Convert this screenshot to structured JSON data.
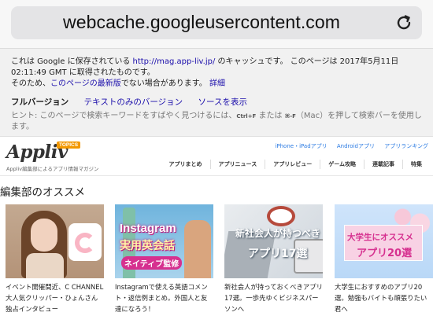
{
  "browser": {
    "url": "webcache.googleusercontent.com",
    "reload_icon": "reload-icon"
  },
  "cache_notice": {
    "line1_pre": "これは Google に保存されている ",
    "line1_link": "http://mag.app-liv.jp/",
    "line1_post": " のキャッシュです。 このページは 2017年5月11日",
    "line2": "02:11:49 GMT に取得されたものです。",
    "line3_pre": "そのため、",
    "line3_link": "このページの最新版",
    "line3_mid": "でない場合があります。 ",
    "line3_link2": "詳細",
    "full_version": "フルバージョン",
    "text_only": "テキストのみのバージョン",
    "view_source": "ソースを表示",
    "hint_pre": "ヒント: このページで検索キーワードをすばやく見つけるには、",
    "hint_key1": "Ctrl+F",
    "hint_mid": " または ",
    "hint_key2": "⌘-F",
    "hint_post": "（Mac）を押して検索バーを使用します。"
  },
  "site": {
    "logo_text": "Appliv",
    "logo_badge": "TOPICS",
    "tagline": "Appliv編集部によるアプリ情報マガジン",
    "top_links": [
      "iPhone・iPadアプリ",
      "Androidアプリ",
      "アプリランキング"
    ],
    "nav": [
      "アプリまとめ",
      "アプリニュース",
      "アプリレビュー",
      "ゲーム攻略",
      "連載記事",
      "特集"
    ]
  },
  "section": {
    "title": "編集部のオススメ"
  },
  "cards": [
    {
      "thumb_text": [],
      "caption": "イベント開催間近、C CHANNEL大人気クリッパー・ひょんさん独占インタビュー"
    },
    {
      "thumb_text": [
        "Instagram",
        "実用英会話",
        "ネイティブ監修"
      ],
      "caption": "Instagramで使える英語コメント・返信例まとめ。外国人と友達になろう！"
    },
    {
      "thumb_text": [
        "新社会人が持つべき",
        "アプリ17選"
      ],
      "caption": "新社会人が持っておくべきアプリ17選。一歩先ゆくビジネスパーソンへ"
    },
    {
      "thumb_text": [
        "大学生にオススメ",
        "アプリ20選"
      ],
      "caption": "大学生におすすめのアプリ20選。勉強もバイトも頑張りたい君へ"
    }
  ]
}
